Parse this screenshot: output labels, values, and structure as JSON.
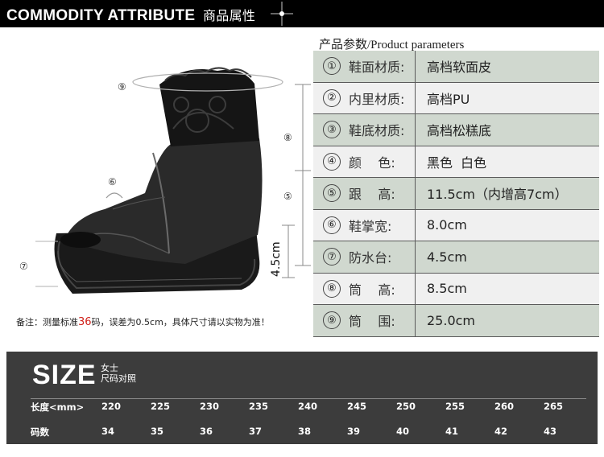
{
  "banner": {
    "title_en": "COMMODITY ATTRIBUTE",
    "title_cn": "商品属性"
  },
  "params": {
    "title": "产品参数/Product parameters",
    "rows": [
      {
        "num": "①",
        "key": "鞋面材质:",
        "value": "高档软面皮"
      },
      {
        "num": "②",
        "key": "内里材质:",
        "value": "高档PU"
      },
      {
        "num": "③",
        "key": "鞋底材质:",
        "value": "高档松糕底"
      },
      {
        "num": "④",
        "key": "颜    色:",
        "value": "黑色  白色"
      },
      {
        "num": "⑤",
        "key": "跟    高:",
        "value": "11.5cm（内增高7cm）"
      },
      {
        "num": "⑥",
        "key": "鞋掌宽:",
        "value": "8.0cm"
      },
      {
        "num": "⑦",
        "key": "防水台:",
        "value": "4.5cm"
      },
      {
        "num": "⑧",
        "key": "筒    高:",
        "value": "8.5cm"
      },
      {
        "num": "⑨",
        "key": "筒    围:",
        "value": "25.0cm"
      }
    ]
  },
  "illustration": {
    "markers": [
      "⑨",
      "⑥",
      "⑦",
      "⑧",
      "⑤"
    ],
    "side_label": "4.5cm",
    "note_prefix": "备注：测量标准",
    "note_highlight": "36",
    "note_suffix": "码，误差为0.5cm，具体尺寸请以实物为准！"
  },
  "size_chart": {
    "big_label": "SIZE",
    "sub1": "女士",
    "sub2": "尺码对照",
    "row1_label": "长度<mm>",
    "row1": [
      "220",
      "225",
      "230",
      "235",
      "240",
      "245",
      "250",
      "255",
      "260",
      "265"
    ],
    "row2_label": "码数",
    "row2": [
      "34",
      "35",
      "36",
      "37",
      "38",
      "39",
      "40",
      "41",
      "42",
      "43"
    ]
  }
}
